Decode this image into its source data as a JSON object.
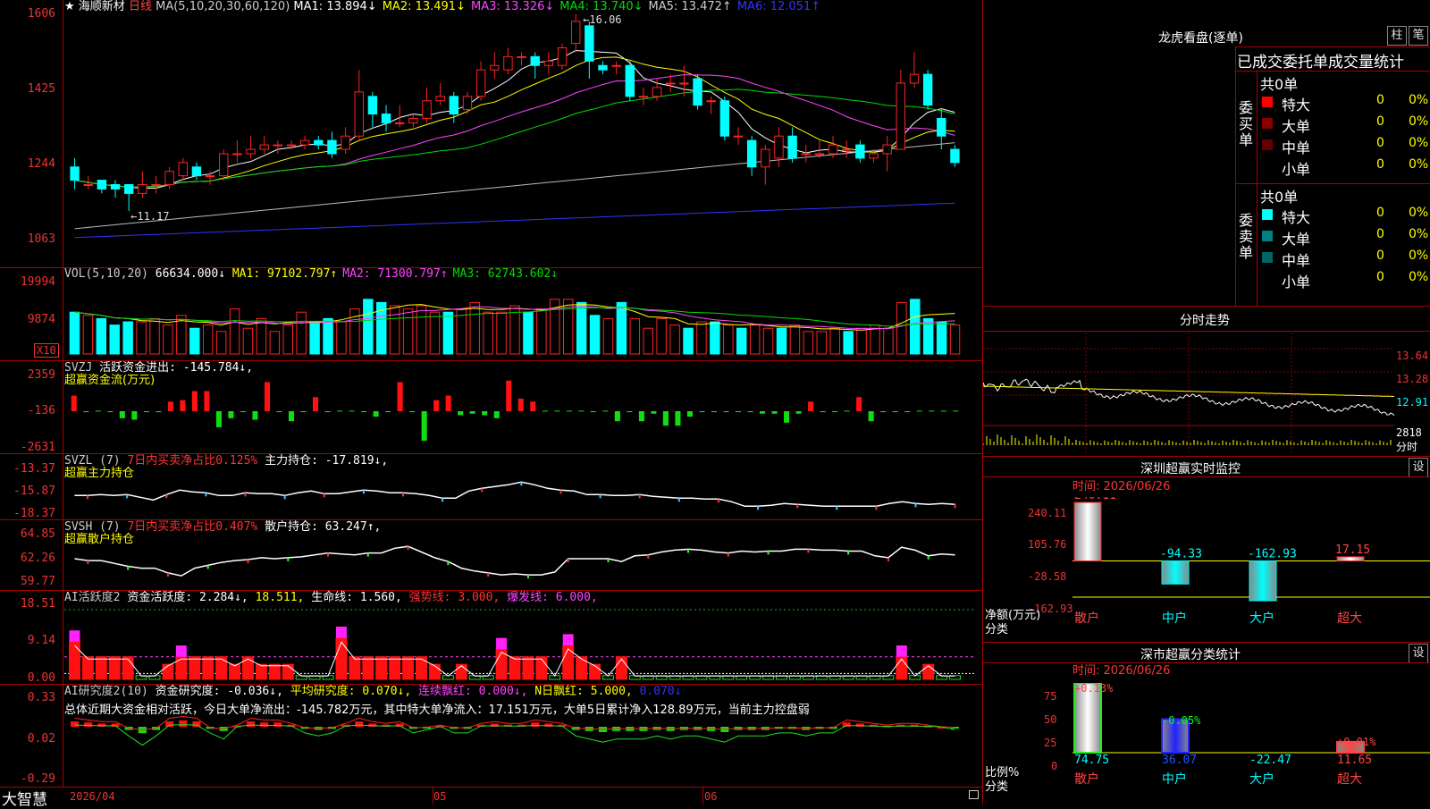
{
  "app": {
    "name": "大智慧"
  },
  "stock": {
    "star": "★",
    "name": "海顺新材",
    "period": "日线"
  },
  "panels": {
    "kline": {
      "y_labels": [
        "1606",
        "1425",
        "1244",
        "1063"
      ],
      "ma_label": "MA(5,10,20,30,60,120)",
      "ma": [
        {
          "t": "MA1:",
          "v": "13.894↓",
          "c": "#ffffff"
        },
        {
          "t": "MA2:",
          "v": "13.491↓",
          "c": "#ffff00"
        },
        {
          "t": "MA3:",
          "v": "13.326↓",
          "c": "#ff44ff"
        },
        {
          "t": "MA4:",
          "v": "13.740↓",
          "c": "#00dd00"
        },
        {
          "t": "MA5:",
          "v": "13.472↑",
          "c": "#cccccc"
        },
        {
          "t": "MA6:",
          "v": "12.051↑",
          "c": "#3333ff"
        }
      ],
      "high_label": "16.06",
      "low_label": "11.17"
    },
    "vol": {
      "y_labels": [
        "19994",
        "9874"
      ],
      "unit": "X10",
      "label": "VOL(5,10,20)",
      "value": "66634.000↓",
      "ma": [
        {
          "t": "MA1:",
          "v": "97102.797↑",
          "c": "#ffff00"
        },
        {
          "t": "MA2:",
          "v": "71300.797↑",
          "c": "#ff44ff"
        },
        {
          "t": "MA3:",
          "v": "62743.602↓",
          "c": "#00dd00"
        }
      ]
    },
    "svzj": {
      "y_labels": [
        "2359",
        "-136",
        "-2631"
      ],
      "label": "SVZJ",
      "item": "活跃资金进出: -145.784↓,",
      "sub": "超赢资金流(万元)"
    },
    "svzl": {
      "y_labels": [
        "-13.37",
        "-15.87",
        "-18.37"
      ],
      "label": "SVZL (7)",
      "pct": "7日内买卖净占比0.125%",
      "item": "主力持仓: -17.819↓,",
      "sub": "超赢主力持仓"
    },
    "svsh": {
      "y_labels": [
        "64.85",
        "62.26",
        "59.77"
      ],
      "label": "SVSH (7)",
      "pct": "7日内买卖净占比0.407%",
      "item": "散户持仓: 63.247↑,",
      "sub": "超赢散户持仓"
    },
    "ai1": {
      "y_labels": [
        "18.51",
        "9.14",
        "0.00"
      ],
      "label": "AI活跃度2",
      "i1": "资金活跃度: 2.284↓,",
      "i2": "18.511,",
      "i3": "生命线: 1.560,",
      "i4": "强势线: 3.000,",
      "i5": "爆发线: 6.000,"
    },
    "ai2": {
      "y_labels": [
        "0.33",
        "0.02",
        "-0.29"
      ],
      "label": "AI研究度2(10)",
      "i1": "资金研究度: -0.036↓,",
      "i2": "平均研究度: 0.070↓,",
      "i3": "连续飘红: 0.000↓,",
      "i4": "N日飘红: 5.000,",
      "i5": "0.070↓",
      "summary": "总体近期大资金相对活跃，今日大单净流出：-145.782万元，其中特大单净流入：17.151万元，大单5日累计净入128.89万元，当前主力控盘弱"
    }
  },
  "x_axis": {
    "labels": [
      "2026/04",
      "05",
      "06"
    ]
  },
  "right": {
    "lhb_title": "龙虎看盘(逐单)",
    "btn1": "柱",
    "btn2": "笔",
    "tabs": [
      "已成交",
      "委托单",
      "成交量统计"
    ],
    "buy": {
      "side": "委买单",
      "total": "共0单",
      "rows": [
        {
          "n": "特大",
          "a": "0",
          "p": "0%",
          "c": "#ff0000"
        },
        {
          "n": "大单",
          "a": "0",
          "p": "0%",
          "c": "#880000"
        },
        {
          "n": "中单",
          "a": "0",
          "p": "0%",
          "c": "#660000"
        },
        {
          "n": "小单",
          "a": "0",
          "p": "0%",
          "c": ""
        }
      ]
    },
    "sell": {
      "side": "委卖单",
      "total": "共0单",
      "rows": [
        {
          "n": "特大",
          "a": "0",
          "p": "0%",
          "c": "#00ffff"
        },
        {
          "n": "大单",
          "a": "0",
          "p": "0%",
          "c": "#008080"
        },
        {
          "n": "中单",
          "a": "0",
          "p": "0%",
          "c": "#006666"
        },
        {
          "n": "小单",
          "a": "0",
          "p": "0%",
          "c": ""
        }
      ]
    },
    "fs": {
      "title": "分时走势",
      "y_labels": [
        "13.64",
        "13.28",
        "12.91",
        "2818"
      ],
      "vol_label": "分时"
    },
    "sz": {
      "title": "深圳超赢实时监控",
      "btn": "设",
      "date": "时间: 2026/06/26",
      "y_labels": [
        "240.11",
        "105.76",
        "-28.58",
        "-162.93"
      ],
      "axis_title": "净额(万元)",
      "axis_sub": "分类",
      "cats": [
        "散户",
        "中户",
        "大户",
        "超大"
      ],
      "bar_labels": [
        "240.11",
        "-94.33",
        "-162.93",
        "17.15"
      ]
    },
    "ss": {
      "title": "深市超赢分类统计",
      "btn": "设",
      "date": "时间: 2026/06/26",
      "y_labels": [
        "75",
        "50",
        "25",
        "0"
      ],
      "axis_title": "比例%",
      "axis_sub": "分类",
      "cats": [
        "散户",
        "中户",
        "大户",
        "超大"
      ],
      "top_labels": [
        "+0.13%",
        "-0.05%",
        "+0.01%"
      ],
      "bot_labels": [
        "74.75",
        "36.07",
        "-22.47",
        "11.65"
      ]
    }
  },
  "chart_data": [
    {
      "type": "candlestick",
      "title": "",
      "price_range": [
        10.63,
        16.06
      ],
      "series": [
        {
          "o": 12.6,
          "c": 12.3,
          "h": 12.8,
          "l": 12.1
        },
        {
          "o": 12.2,
          "c": 12.2,
          "h": 12.4,
          "l": 12.1
        },
        {
          "o": 12.3,
          "c": 12.1,
          "h": 12.3,
          "l": 12.0
        },
        {
          "o": 12.2,
          "c": 12.1,
          "h": 12.3,
          "l": 11.9
        },
        {
          "o": 12.2,
          "c": 12.0,
          "h": 12.2,
          "l": 11.6
        },
        {
          "o": 12.0,
          "c": 12.2,
          "h": 12.5,
          "l": 11.9
        },
        {
          "o": 12.2,
          "c": 12.2,
          "h": 12.4,
          "l": 12.0
        },
        {
          "o": 12.2,
          "c": 12.5,
          "h": 12.6,
          "l": 12.1
        },
        {
          "o": 12.4,
          "c": 12.7,
          "h": 12.8,
          "l": 12.3
        },
        {
          "o": 12.6,
          "c": 12.4,
          "h": 12.7,
          "l": 12.3
        },
        {
          "o": 12.4,
          "c": 12.4,
          "h": 12.5,
          "l": 12.2
        },
        {
          "o": 12.4,
          "c": 12.9,
          "h": 13.0,
          "l": 12.3
        },
        {
          "o": 12.9,
          "c": 12.9,
          "h": 13.2,
          "l": 12.7
        },
        {
          "o": 12.9,
          "c": 13.0,
          "h": 13.3,
          "l": 12.8
        },
        {
          "o": 13.0,
          "c": 13.1,
          "h": 13.3,
          "l": 12.9
        },
        {
          "o": 13.1,
          "c": 13.1,
          "h": 13.2,
          "l": 12.9
        },
        {
          "o": 13.1,
          "c": 13.1,
          "h": 13.2,
          "l": 13.0
        },
        {
          "o": 13.1,
          "c": 13.2,
          "h": 13.3,
          "l": 13.0
        },
        {
          "o": 13.2,
          "c": 13.1,
          "h": 13.3,
          "l": 13.0
        },
        {
          "o": 13.2,
          "c": 12.9,
          "h": 13.4,
          "l": 12.8
        },
        {
          "o": 13.0,
          "c": 13.3,
          "h": 13.5,
          "l": 12.9
        },
        {
          "o": 13.3,
          "c": 14.3,
          "h": 14.8,
          "l": 13.2
        },
        {
          "o": 14.2,
          "c": 13.8,
          "h": 14.3,
          "l": 13.5
        },
        {
          "o": 13.8,
          "c": 13.6,
          "h": 14.0,
          "l": 13.4
        },
        {
          "o": 13.6,
          "c": 13.6,
          "h": 14.0,
          "l": 13.5
        },
        {
          "o": 13.6,
          "c": 13.7,
          "h": 13.8,
          "l": 13.5
        },
        {
          "o": 13.7,
          "c": 14.1,
          "h": 14.4,
          "l": 13.6
        },
        {
          "o": 14.1,
          "c": 14.2,
          "h": 14.5,
          "l": 14.0
        },
        {
          "o": 14.2,
          "c": 13.8,
          "h": 14.3,
          "l": 13.6
        },
        {
          "o": 13.9,
          "c": 14.2,
          "h": 14.3,
          "l": 13.8
        },
        {
          "o": 14.2,
          "c": 14.8,
          "h": 15.0,
          "l": 14.1
        },
        {
          "o": 14.8,
          "c": 14.9,
          "h": 15.2,
          "l": 14.6
        },
        {
          "o": 14.8,
          "c": 15.1,
          "h": 15.3,
          "l": 14.7
        },
        {
          "o": 15.1,
          "c": 15.1,
          "h": 15.2,
          "l": 14.9
        },
        {
          "o": 15.1,
          "c": 14.9,
          "h": 15.2,
          "l": 14.6
        },
        {
          "o": 14.9,
          "c": 15.0,
          "h": 15.2,
          "l": 14.7
        },
        {
          "o": 14.9,
          "c": 15.3,
          "h": 15.4,
          "l": 14.8
        },
        {
          "o": 15.4,
          "c": 15.9,
          "h": 16.06,
          "l": 15.2
        },
        {
          "o": 15.8,
          "c": 15.0,
          "h": 15.9,
          "l": 14.6
        },
        {
          "o": 14.9,
          "c": 14.8,
          "h": 15.0,
          "l": 14.7
        },
        {
          "o": 14.9,
          "c": 14.9,
          "h": 15.0,
          "l": 14.7
        },
        {
          "o": 14.9,
          "c": 14.2,
          "h": 15.0,
          "l": 14.1
        },
        {
          "o": 14.2,
          "c": 14.2,
          "h": 14.4,
          "l": 14.0
        },
        {
          "o": 14.2,
          "c": 14.4,
          "h": 14.6,
          "l": 14.1
        },
        {
          "o": 14.5,
          "c": 14.5,
          "h": 14.7,
          "l": 14.3
        },
        {
          "o": 14.5,
          "c": 14.5,
          "h": 14.9,
          "l": 14.2
        },
        {
          "o": 14.6,
          "c": 14.0,
          "h": 14.7,
          "l": 13.9
        },
        {
          "o": 14.1,
          "c": 14.1,
          "h": 14.2,
          "l": 13.8
        },
        {
          "o": 14.1,
          "c": 13.3,
          "h": 14.2,
          "l": 13.2
        },
        {
          "o": 13.3,
          "c": 13.3,
          "h": 13.5,
          "l": 13.1
        },
        {
          "o": 13.2,
          "c": 12.6,
          "h": 13.3,
          "l": 12.4
        },
        {
          "o": 12.6,
          "c": 13.0,
          "h": 13.1,
          "l": 12.2
        },
        {
          "o": 12.8,
          "c": 13.3,
          "h": 13.5,
          "l": 12.6
        },
        {
          "o": 13.3,
          "c": 12.8,
          "h": 13.5,
          "l": 12.7
        },
        {
          "o": 12.9,
          "c": 12.9,
          "h": 13.1,
          "l": 12.7
        },
        {
          "o": 12.9,
          "c": 12.9,
          "h": 13.2,
          "l": 12.8
        },
        {
          "o": 12.9,
          "c": 13.1,
          "h": 13.3,
          "l": 12.8
        },
        {
          "o": 13.0,
          "c": 13.0,
          "h": 13.2,
          "l": 12.8
        },
        {
          "o": 13.1,
          "c": 12.8,
          "h": 13.2,
          "l": 12.7
        },
        {
          "o": 12.8,
          "c": 12.9,
          "h": 13.0,
          "l": 12.7
        },
        {
          "o": 12.9,
          "c": 13.1,
          "h": 13.3,
          "l": 12.5
        },
        {
          "o": 13.0,
          "c": 14.5,
          "h": 14.8,
          "l": 13.0
        },
        {
          "o": 14.5,
          "c": 14.7,
          "h": 15.2,
          "l": 14.4
        },
        {
          "o": 14.7,
          "c": 14.0,
          "h": 14.8,
          "l": 13.9
        },
        {
          "o": 13.7,
          "c": 13.3,
          "h": 13.9,
          "l": 13.0
        },
        {
          "o": 13.0,
          "c": 12.7,
          "h": 13.1,
          "l": 12.6
        }
      ]
    },
    {
      "type": "bar",
      "title": "",
      "ylim": [
        0,
        19994
      ],
      "values": [
        13,
        12,
        11,
        9,
        10,
        10,
        11,
        9,
        12,
        8,
        9,
        7,
        14,
        8,
        11,
        7,
        9,
        13,
        10,
        11,
        10,
        14,
        17,
        16,
        15,
        14,
        15,
        13,
        13,
        14,
        16,
        13,
        13,
        15,
        13,
        14,
        17,
        17,
        16,
        12,
        11,
        16,
        11,
        8,
        11,
        9,
        8,
        10,
        10,
        9,
        8,
        9,
        8,
        8,
        9,
        7,
        7,
        8,
        7,
        8,
        9,
        8,
        16,
        17,
        11,
        10,
        9
      ]
    },
    {
      "type": "bar",
      "title": "",
      "ylim": [
        -2631,
        2359
      ],
      "values": [
        900,
        -200,
        -100,
        -200,
        -600,
        -700,
        -200,
        -200,
        500,
        600,
        1200,
        1200,
        -1200,
        -600,
        -200,
        -700,
        1800,
        -200,
        -800,
        -200,
        800,
        -200,
        -100,
        -100,
        -200,
        -500,
        -200,
        1800,
        -200,
        -2100,
        600,
        900,
        -400,
        -300,
        -400,
        -600,
        1900,
        700,
        500,
        -100,
        -100,
        -100,
        -100,
        -200,
        -100,
        -800,
        -200,
        -800,
        -300,
        -1100,
        -1100,
        -500,
        -200,
        -200,
        -200,
        -200,
        -200,
        -300,
        -300,
        -900,
        -300,
        500,
        -200,
        -200,
        -100,
        800,
        -800,
        -200,
        -200,
        -200,
        -100,
        -100,
        -100,
        -100
      ]
    },
    {
      "type": "line",
      "title": "",
      "ylim": [
        -18.37,
        -13.37
      ],
      "values": [
        -16.2,
        -16.2,
        -16.1,
        -16.2,
        -16.1,
        -16.4,
        -16.7,
        -16.1,
        -15.6,
        -15.8,
        -15.9,
        -16.2,
        -16.2,
        -15.9,
        -16.0,
        -16.0,
        -16.2,
        -15.9,
        -15.7,
        -16.0,
        -16.0,
        -15.8,
        -15.6,
        -15.7,
        -15.9,
        -15.9,
        -16.0,
        -16.2,
        -16.5,
        -16.5,
        -15.7,
        -15.4,
        -15.2,
        -15.0,
        -14.7,
        -15.0,
        -15.4,
        -15.6,
        -15.7,
        -16.1,
        -16.1,
        -16.2,
        -16.2,
        -16.1,
        -16.3,
        -16.4,
        -16.5,
        -16.5,
        -16.6,
        -16.6,
        -16.9,
        -17.4,
        -17.4,
        -17.3,
        -17.1,
        -17.2,
        -17.3,
        -17.4,
        -17.4,
        -17.4,
        -17.4,
        -17.4,
        -17.1,
        -16.9,
        -17.1,
        -17.2,
        -17.1,
        -17.2
      ]
    },
    {
      "type": "line",
      "title": "",
      "ylim": [
        59.77,
        64.85
      ],
      "values": [
        62.5,
        62.3,
        62.3,
        62.0,
        61.7,
        61.5,
        61.5,
        61.0,
        60.7,
        61.5,
        61.8,
        62.1,
        62.3,
        62.4,
        62.6,
        62.5,
        62.6,
        62.7,
        62.9,
        63.1,
        63.0,
        62.9,
        63.1,
        63.1,
        63.6,
        63.8,
        63.2,
        62.6,
        62.2,
        61.5,
        61.2,
        61.0,
        60.8,
        60.9,
        60.8,
        60.8,
        61.1,
        62.5,
        62.5,
        62.5,
        62.5,
        62.2,
        62.8,
        62.9,
        63.2,
        63.4,
        63.5,
        63.4,
        63.2,
        63.1,
        63.3,
        63.2,
        63.3,
        63.3,
        63.5,
        63.5,
        63.4,
        63.4,
        63.3,
        63.3,
        62.8,
        62.6,
        63.7,
        63.4,
        62.8,
        63.0,
        62.9
      ]
    },
    {
      "type": "bar",
      "title": "",
      "ylim": [
        0,
        18.51
      ],
      "values": [
        10,
        6,
        6,
        6,
        6,
        1,
        1,
        4,
        6,
        6,
        6,
        6,
        4,
        6,
        4,
        4,
        4,
        1,
        1,
        1,
        11,
        6,
        6,
        6,
        6,
        6,
        6,
        4,
        1,
        4,
        1,
        1,
        8,
        6,
        6,
        6,
        1,
        9,
        6,
        4,
        1,
        6,
        1,
        1,
        1,
        1,
        1,
        1,
        1,
        1,
        1,
        1,
        1,
        1,
        1,
        1,
        1,
        1,
        1,
        1,
        1,
        1,
        6,
        1,
        4,
        1,
        1
      ],
      "magenta": [
        1,
        0,
        0,
        0,
        0,
        0,
        0,
        0,
        1,
        0,
        0,
        0,
        0,
        0,
        0,
        0,
        0,
        0,
        0,
        0,
        1,
        0,
        0,
        0,
        0,
        0,
        0,
        0,
        0,
        0,
        0,
        0,
        1,
        0,
        0,
        0,
        0,
        1,
        0,
        0,
        0,
        0,
        0,
        0,
        0,
        0,
        0,
        0,
        0,
        0,
        0,
        0,
        0,
        0,
        0,
        0,
        0,
        0,
        0,
        0,
        0,
        0,
        1,
        0,
        0,
        0,
        0
      ]
    },
    {
      "type": "bar",
      "title": "",
      "ylim": [
        -0.29,
        0.33
      ],
      "values": [
        0.05,
        0.04,
        0.03,
        0.03,
        -0.03,
        -0.06,
        -0.03,
        0.05,
        0.06,
        0.05,
        -0.02,
        -0.04,
        0.01,
        0.05,
        0.04,
        0.04,
        0.02,
        -0.02,
        -0.03,
        -0.02,
        0.02,
        0.05,
        0.03,
        0.02,
        0.03,
        -0.02,
        -0.01,
        0.01,
        -0.02,
        -0.02,
        0.02,
        0.03,
        0.02,
        0.02,
        0.04,
        0.03,
        0.02,
        -0.03,
        -0.04,
        -0.05,
        -0.04,
        -0.04,
        -0.04,
        -0.03,
        -0.04,
        -0.03,
        -0.03,
        -0.04,
        -0.05,
        -0.03,
        -0.03,
        -0.03,
        -0.02,
        -0.02,
        -0.03,
        -0.02,
        -0.02,
        0.04,
        0.03,
        0.02,
        0.01,
        0.02,
        0.02,
        0.01,
        0.0,
        -0.01
      ]
    }
  ]
}
